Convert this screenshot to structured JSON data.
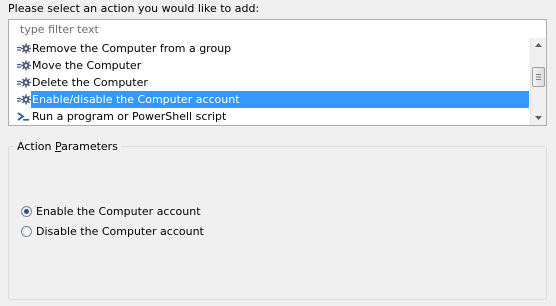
{
  "prompt": "Please select an action you would like to add:",
  "filter": {
    "placeholder": "type filter text",
    "value": ""
  },
  "actions": {
    "items": [
      {
        "label": "Remove the Computer from a group",
        "icon": "gear-arrow-icon",
        "selected": false
      },
      {
        "label": "Move the Computer",
        "icon": "gear-arrow-icon",
        "selected": false
      },
      {
        "label": "Delete the Computer",
        "icon": "gear-arrow-icon",
        "selected": false
      },
      {
        "label": "Enable/disable the Computer account",
        "icon": "gear-arrow-icon",
        "selected": true
      },
      {
        "label": "Run a program or PowerShell script",
        "icon": "powershell-icon",
        "selected": false
      }
    ]
  },
  "parameters": {
    "title": "Action Parameters",
    "title_underlined_letter": "P",
    "options": [
      {
        "label": "Enable the Computer account",
        "checked": true
      },
      {
        "label": "Disable the Computer account",
        "checked": false
      }
    ]
  },
  "colors": {
    "selection": "#3399ff",
    "window_background": "#f0f0f0"
  }
}
